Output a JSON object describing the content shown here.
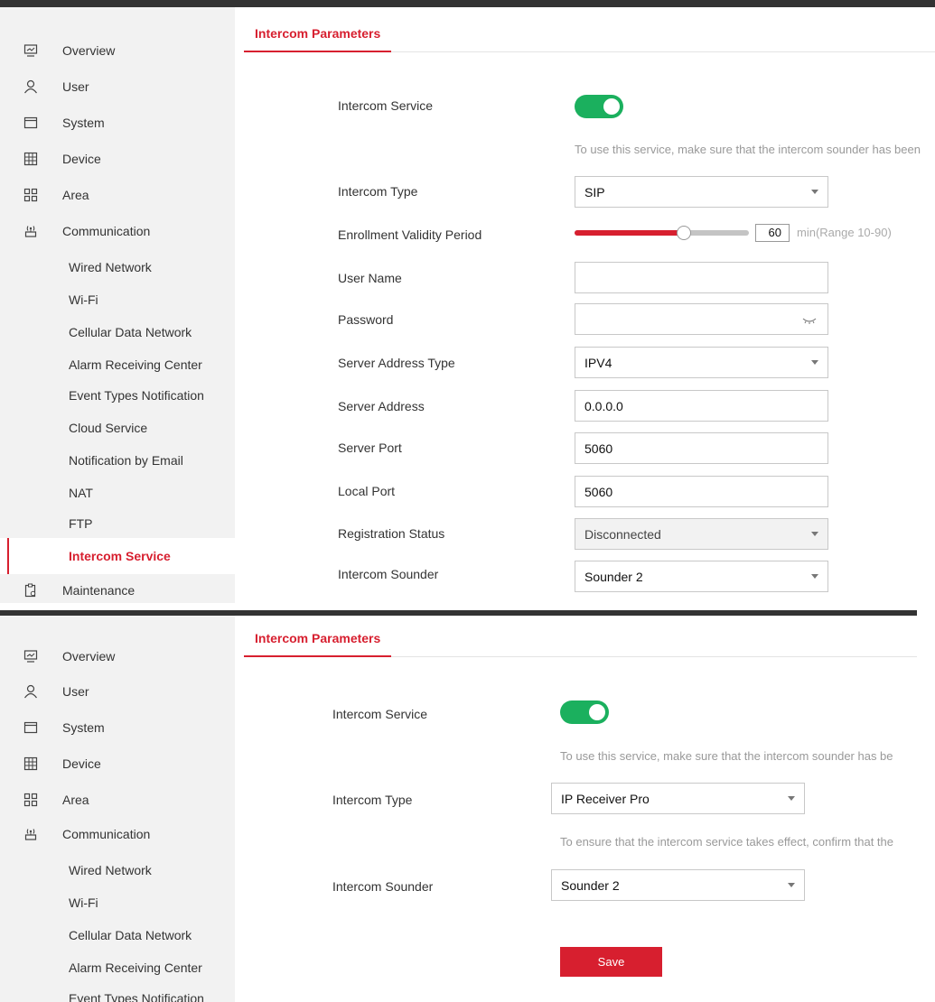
{
  "screens": [
    {
      "tab_label": "Intercom Parameters",
      "nav": [
        {
          "label": "Overview",
          "icon": "monitor-icon"
        },
        {
          "label": "User",
          "icon": "user-icon"
        },
        {
          "label": "System",
          "icon": "window-icon"
        },
        {
          "label": "Device",
          "icon": "device-grid-icon"
        },
        {
          "label": "Area",
          "icon": "area-grid-icon"
        },
        {
          "label": "Communication",
          "icon": "antenna-icon"
        },
        {
          "label": "Wired Network"
        },
        {
          "label": "Wi-Fi"
        },
        {
          "label": "Cellular Data Network"
        },
        {
          "label": "Alarm Receiving Center"
        },
        {
          "label": "Event Types Notification"
        },
        {
          "label": "Cloud Service"
        },
        {
          "label": "Notification by Email"
        },
        {
          "label": "NAT"
        },
        {
          "label": "FTP"
        },
        {
          "label": "Intercom Service",
          "active": true
        },
        {
          "label": "Maintenance",
          "icon": "maintenance-icon"
        }
      ],
      "form": {
        "intercom_service_label": "Intercom Service",
        "intercom_service_on": true,
        "service_hint": "To use this service, make sure that the intercom sounder has been",
        "intercom_type_label": "Intercom Type",
        "intercom_type_value": "SIP",
        "enrollment_label": "Enrollment Validity Period",
        "enrollment_value": "60",
        "enrollment_min": 10,
        "enrollment_max": 90,
        "enrollment_hint": "min(Range 10-90)",
        "user_name_label": "User Name",
        "user_name_value": "",
        "password_label": "Password",
        "password_value": "",
        "server_address_type_label": "Server Address Type",
        "server_address_type_value": "IPV4",
        "server_address_label": "Server Address",
        "server_address_value": "0.0.0.0",
        "server_port_label": "Server Port",
        "server_port_value": "5060",
        "local_port_label": "Local Port",
        "local_port_value": "5060",
        "registration_status_label": "Registration Status",
        "registration_status_value": "Disconnected",
        "intercom_sounder_label": "Intercom Sounder",
        "intercom_sounder_value": "Sounder 2"
      }
    },
    {
      "tab_label": "Intercom Parameters",
      "nav": [
        {
          "label": "Overview",
          "icon": "monitor-icon"
        },
        {
          "label": "User",
          "icon": "user-icon"
        },
        {
          "label": "System",
          "icon": "window-icon"
        },
        {
          "label": "Device",
          "icon": "device-grid-icon"
        },
        {
          "label": "Area",
          "icon": "area-grid-icon"
        },
        {
          "label": "Communication",
          "icon": "antenna-icon"
        },
        {
          "label": "Wired Network"
        },
        {
          "label": "Wi-Fi"
        },
        {
          "label": "Cellular Data Network"
        },
        {
          "label": "Alarm Receiving Center"
        },
        {
          "label": "Event Types Notification"
        }
      ],
      "form": {
        "intercom_service_label": "Intercom Service",
        "intercom_service_on": true,
        "service_hint": "To use this service, make sure that the intercom sounder has be",
        "intercom_type_label": "Intercom Type",
        "intercom_type_value": "IP Receiver Pro",
        "type_hint": "To ensure that the intercom service takes effect, confirm that the",
        "intercom_sounder_label": "Intercom Sounder",
        "intercom_sounder_value": "Sounder 2",
        "save_label": "Save"
      }
    }
  ],
  "colors": {
    "accent": "#d71f2f",
    "toggle_on": "#1bb05e",
    "sidebar_bg": "#f2f2f2"
  }
}
